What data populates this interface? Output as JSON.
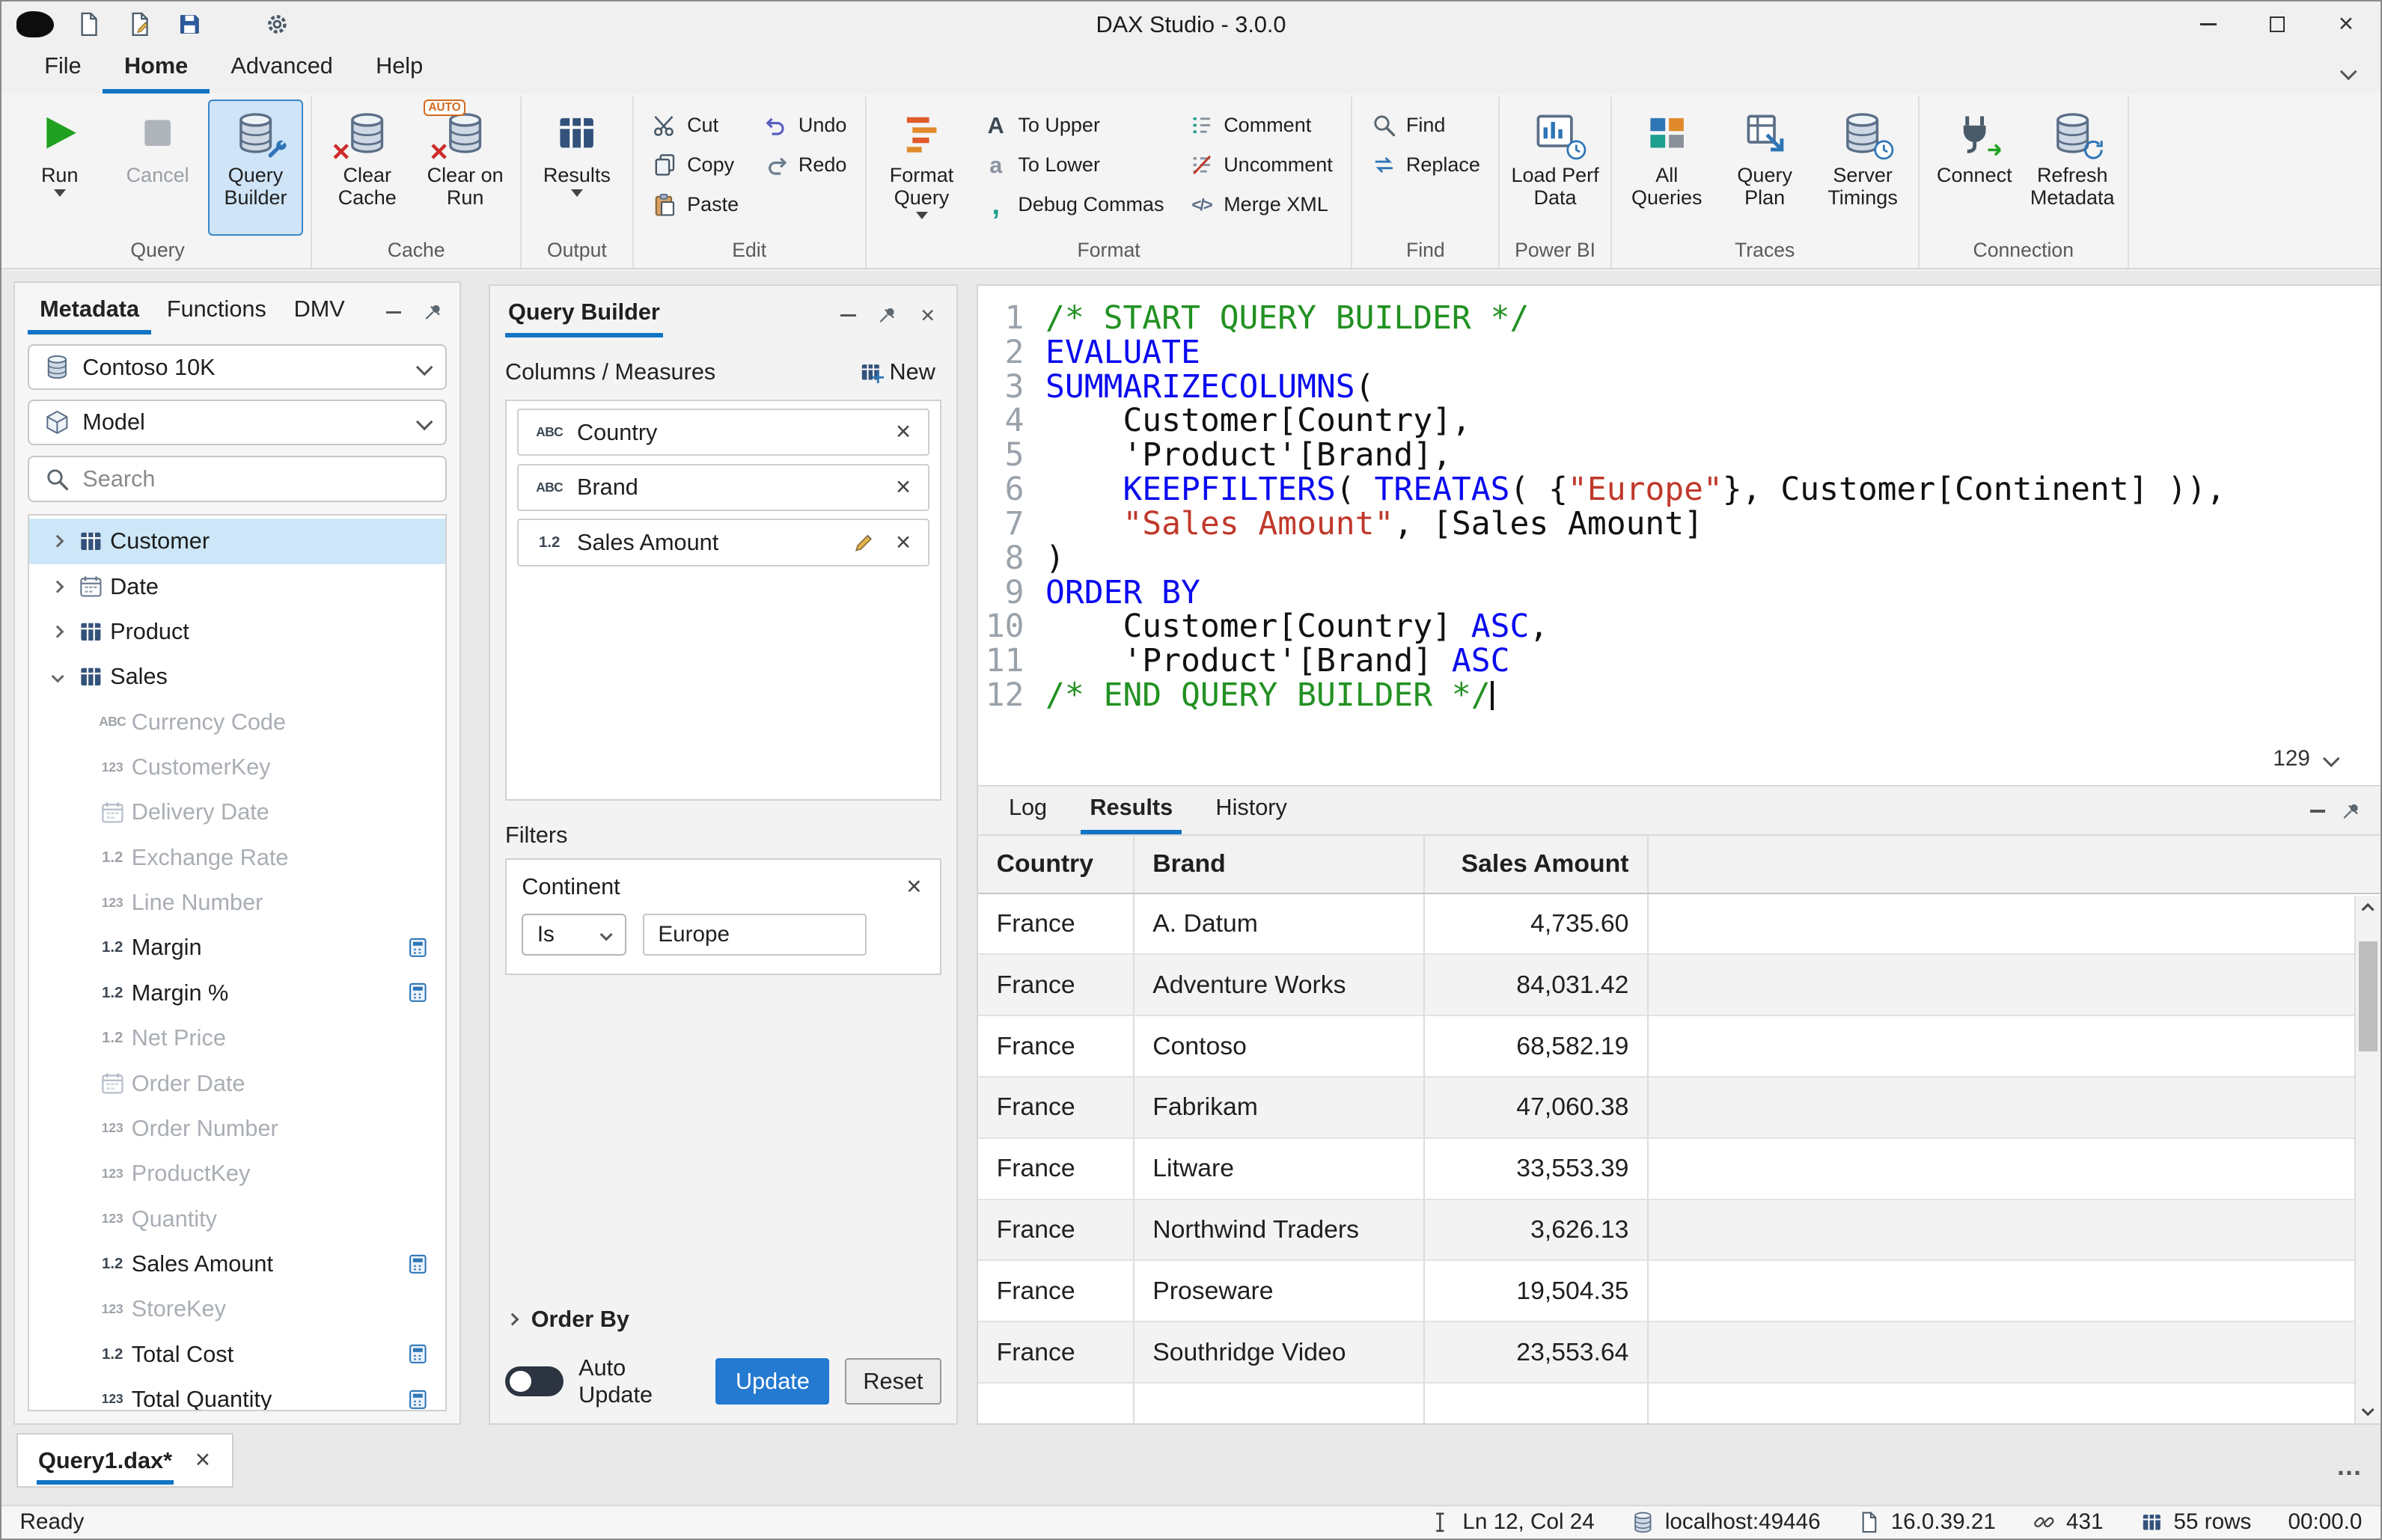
{
  "window": {
    "title": "DAX Studio - 3.0.0",
    "close_glyph": "×"
  },
  "menu": {
    "tabs": [
      "File",
      "Home",
      "Advanced",
      "Help"
    ],
    "active_tab": "Home"
  },
  "ribbon": {
    "query": {
      "caption": "Query",
      "run": "Run",
      "cancel": "Cancel",
      "query_builder": "Query Builder"
    },
    "cache": {
      "caption": "Cache",
      "clear_cache": "Clear Cache",
      "clear_on_run": "Clear on Run",
      "auto_badge": "AUTO"
    },
    "output": {
      "caption": "Output",
      "results": "Results"
    },
    "edit": {
      "caption": "Edit",
      "cut": "Cut",
      "copy": "Copy",
      "paste": "Paste",
      "undo": "Undo",
      "redo": "Redo"
    },
    "format": {
      "caption": "Format",
      "format_query": "Format Query",
      "to_upper": "To Upper",
      "to_lower": "To Lower",
      "debug_commas": "Debug Commas",
      "comment": "Comment",
      "uncomment": "Uncomment",
      "merge_xml": "Merge XML"
    },
    "find": {
      "caption": "Find",
      "find": "Find",
      "replace": "Replace"
    },
    "powerbi": {
      "caption": "Power BI",
      "load_perf_data": "Load Perf Data"
    },
    "traces": {
      "caption": "Traces",
      "all_queries": "All Queries",
      "query_plan": "Query Plan",
      "server_timings": "Server Timings"
    },
    "connection": {
      "caption": "Connection",
      "connect": "Connect",
      "refresh_metadata": "Refresh Metadata"
    }
  },
  "metadata_panel": {
    "tabs": [
      "Metadata",
      "Functions",
      "DMV"
    ],
    "active_tab": "Metadata",
    "database": "Contoso 10K",
    "model": "Model",
    "search_placeholder": "Search",
    "tree": [
      {
        "label": "Customer",
        "icon": "table",
        "level": 0,
        "expander": "collapsed",
        "selected": true
      },
      {
        "label": "Date",
        "icon": "calendar",
        "level": 0,
        "expander": "collapsed"
      },
      {
        "label": "Product",
        "icon": "table",
        "level": 0,
        "expander": "collapsed"
      },
      {
        "label": "Sales",
        "icon": "table",
        "level": 0,
        "expander": "expanded"
      },
      {
        "label": "Currency Code",
        "icon": "text",
        "level": 1,
        "muted": true
      },
      {
        "label": "CustomerKey",
        "icon": "int",
        "level": 1,
        "muted": true
      },
      {
        "label": "Delivery Date",
        "icon": "calendar",
        "level": 1,
        "muted": true
      },
      {
        "label": "Exchange Rate",
        "icon": "dec",
        "level": 1,
        "muted": true
      },
      {
        "label": "Line Number",
        "icon": "int",
        "level": 1,
        "muted": true
      },
      {
        "label": "Margin",
        "icon": "dec",
        "level": 1,
        "measure": true
      },
      {
        "label": "Margin %",
        "icon": "dec",
        "level": 1,
        "measure": true
      },
      {
        "label": "Net Price",
        "icon": "dec",
        "level": 1,
        "muted": true
      },
      {
        "label": "Order Date",
        "icon": "calendar",
        "level": 1,
        "muted": true
      },
      {
        "label": "Order Number",
        "icon": "int",
        "level": 1,
        "muted": true
      },
      {
        "label": "ProductKey",
        "icon": "int",
        "level": 1,
        "muted": true
      },
      {
        "label": "Quantity",
        "icon": "int",
        "level": 1,
        "muted": true
      },
      {
        "label": "Sales Amount",
        "icon": "dec",
        "level": 1,
        "measure": true
      },
      {
        "label": "StoreKey",
        "icon": "int",
        "level": 1,
        "muted": true
      },
      {
        "label": "Total Cost",
        "icon": "dec",
        "level": 1,
        "measure": true
      },
      {
        "label": "Total Quantity",
        "icon": "int",
        "level": 1,
        "measure": true
      }
    ]
  },
  "query_builder": {
    "title": "Query Builder",
    "columns_header": "Columns / Measures",
    "new_button": "New",
    "columns": [
      {
        "label": "Country",
        "icon": "text",
        "editable": false
      },
      {
        "label": "Brand",
        "icon": "text",
        "editable": false
      },
      {
        "label": "Sales Amount",
        "icon": "dec",
        "editable": true
      }
    ],
    "filters_header": "Filters",
    "filter": {
      "field": "Continent",
      "operator": "Is",
      "value": "Europe"
    },
    "order_by_label": "Order By",
    "auto_update_label": "Auto Update",
    "auto_update_on": false,
    "update_button": "Update",
    "reset_button": "Reset"
  },
  "editor": {
    "zoom_value": "129",
    "lines": [
      {
        "num": 1,
        "segments": [
          [
            "com",
            "/* START QUERY BUILDER */"
          ]
        ]
      },
      {
        "num": 2,
        "segments": [
          [
            "kw",
            "EVALUATE"
          ]
        ]
      },
      {
        "num": 3,
        "segments": [
          [
            "kw",
            "SUMMARIZECOLUMNS"
          ],
          [
            "pl",
            "("
          ]
        ]
      },
      {
        "num": 4,
        "segments": [
          [
            "pl",
            "    Customer[Country],"
          ]
        ]
      },
      {
        "num": 5,
        "segments": [
          [
            "pl",
            "    'Product'[Brand],"
          ]
        ]
      },
      {
        "num": 6,
        "segments": [
          [
            "pl",
            "    "
          ],
          [
            "kw",
            "KEEPFILTERS"
          ],
          [
            "pl",
            "( "
          ],
          [
            "kw",
            "TREATAS"
          ],
          [
            "pl",
            "( {"
          ],
          [
            "str",
            "\"Europe\""
          ],
          [
            "pl",
            "}, Customer[Continent] )),"
          ]
        ]
      },
      {
        "num": 7,
        "segments": [
          [
            "pl",
            "    "
          ],
          [
            "str",
            "\"Sales Amount\""
          ],
          [
            "pl",
            ", [Sales Amount]"
          ]
        ]
      },
      {
        "num": 8,
        "segments": [
          [
            "pl",
            ")"
          ]
        ]
      },
      {
        "num": 9,
        "segments": [
          [
            "kw",
            "ORDER BY"
          ]
        ]
      },
      {
        "num": 10,
        "segments": [
          [
            "pl",
            "    Customer[Country] "
          ],
          [
            "kw",
            "ASC"
          ],
          [
            "pl",
            ","
          ]
        ]
      },
      {
        "num": 11,
        "segments": [
          [
            "pl",
            "    'Product'[Brand] "
          ],
          [
            "kw",
            "ASC"
          ]
        ]
      },
      {
        "num": 12,
        "segments": [
          [
            "com",
            "/* END QUERY BUILDER */"
          ]
        ],
        "caret": true
      }
    ]
  },
  "results_panel": {
    "tabs": [
      "Log",
      "Results",
      "History"
    ],
    "active_tab": "Results",
    "columns": [
      "Country",
      "Brand",
      "Sales Amount"
    ],
    "rows": [
      [
        "France",
        "A. Datum",
        "4,735.60"
      ],
      [
        "France",
        "Adventure Works",
        "84,031.42"
      ],
      [
        "France",
        "Contoso",
        "68,582.19"
      ],
      [
        "France",
        "Fabrikam",
        "47,060.38"
      ],
      [
        "France",
        "Litware",
        "33,553.39"
      ],
      [
        "France",
        "Northwind Traders",
        "3,626.13"
      ],
      [
        "France",
        "Proseware",
        "19,504.35"
      ],
      [
        "France",
        "Southridge Video",
        "23,553.64"
      ]
    ]
  },
  "document_tab": {
    "label": "Query1.dax*",
    "close_glyph": "×"
  },
  "status_bar": {
    "ready": "Ready",
    "position": "Ln 12, Col 24",
    "server": "localhost:49446",
    "version": "16.0.39.21",
    "connection_id": "431",
    "row_count": "55 rows",
    "elapsed": "00:00.0",
    "overflow": "…"
  }
}
